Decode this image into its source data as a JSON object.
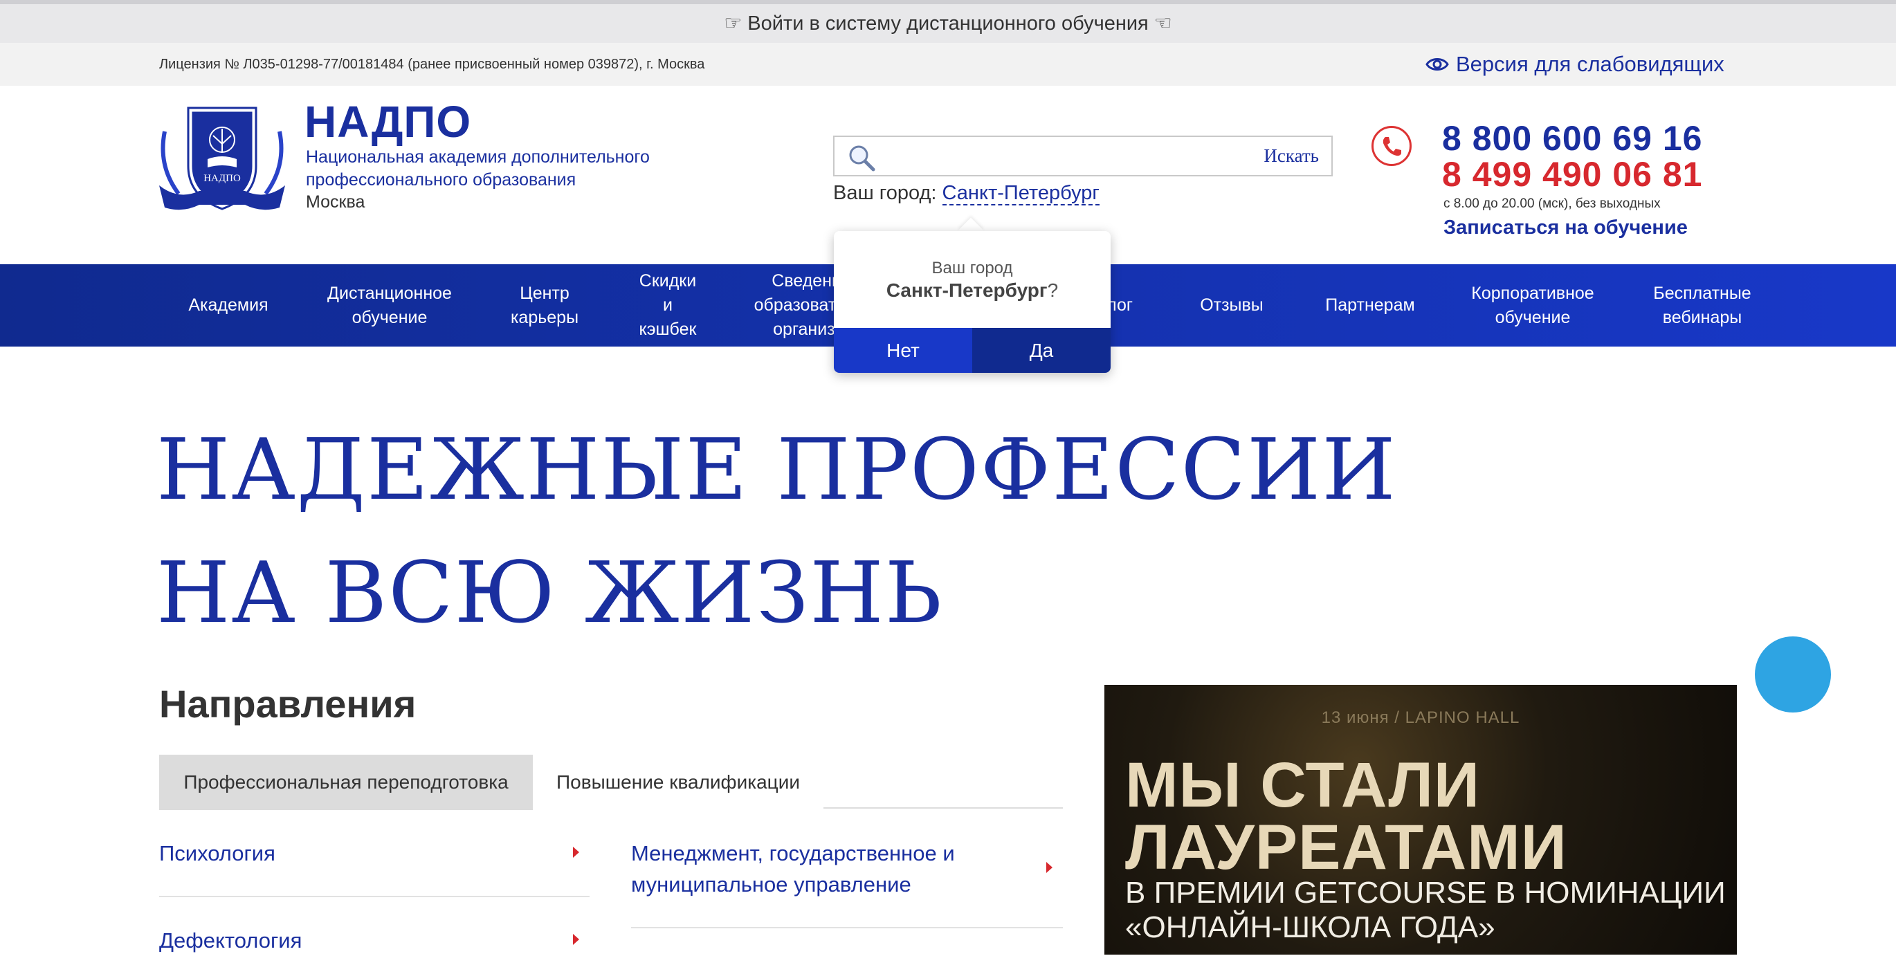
{
  "top_bar": {
    "login_text": "☞ Войти в систему дистанционного обучения ☜"
  },
  "license_bar": {
    "license_text": "Лицензия № Л035-01298-77/00181484 (ранее присвоенный номер 039872), г. Москва",
    "vision_link": "Версия для слабовидящих"
  },
  "header": {
    "brand_name": "НАДПО",
    "brand_sub_line1": "Национальная академия дополнительного",
    "brand_sub_line2": "профессионального образования",
    "brand_city": "Москва",
    "logo_text": "НАДПО",
    "search": {
      "placeholder": "",
      "button_label": "Искать"
    },
    "city_label": "Ваш город:",
    "city_value": "Санкт-Петербург",
    "phone1": "8 800 600 69 16",
    "phone2": "8 499 490 06 81",
    "hours": "с 8.00 до 20.00 (мск), без выходных",
    "enroll_link": "Записаться на обучение"
  },
  "nav": {
    "items": [
      {
        "label": "Академия"
      },
      {
        "label": "Дистанционное\nобучение"
      },
      {
        "label": "Центр\nкарьеры"
      },
      {
        "label": "Скидки\nи\nкэшбек"
      },
      {
        "label": "Сведения об\nобразовательной\nорганизации"
      },
      {
        "label": "Блог"
      },
      {
        "label": "Отзывы"
      },
      {
        "label": "Партнерам"
      },
      {
        "label": "Корпоративное\nобучение"
      },
      {
        "label": "Бесплатные\nвебинары"
      }
    ]
  },
  "city_popup": {
    "label": "Ваш город",
    "city": "Санкт-Петербург",
    "question": "?",
    "no_label": "Нет",
    "yes_label": "Да"
  },
  "hero": {
    "title_line1": "НАДЕЖНЫЕ ПРОФЕССИИ",
    "title_line2": "НА ВСЮ ЖИЗНЬ"
  },
  "directions": {
    "title": "Направления",
    "tabs": [
      {
        "label": "Профессиональная переподготовка",
        "active": true
      },
      {
        "label": "Повышение квалификации",
        "active": false
      }
    ],
    "items_left": [
      "Психология",
      "Дефектология"
    ],
    "items_right": [
      "Менеджмент, государственное и\nмуниципальное управление"
    ]
  },
  "banner": {
    "date": "13 июня / LAPINO HALL",
    "headline_line1": "МЫ СТАЛИ",
    "headline_line2": "ЛАУРЕАТАМИ",
    "sub_line1": "В ПРЕМИИ GETCOURSE В НОМИНАЦИИ",
    "sub_line2": "«ОНЛАЙН-ШКОЛА ГОДА»"
  },
  "colors": {
    "brand_blue": "#1a2f9f",
    "nav_blue": "#1838c8",
    "accent_red": "#d7282e",
    "chat_blue": "#2ea4e3"
  }
}
